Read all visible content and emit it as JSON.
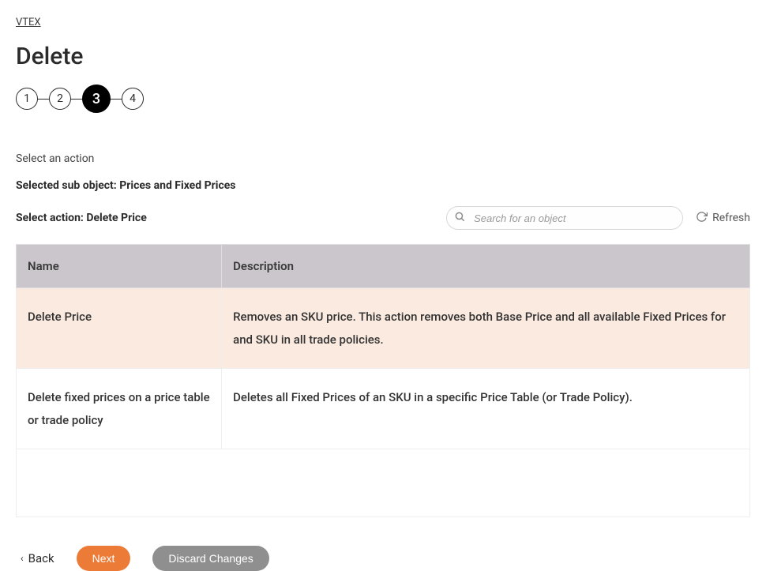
{
  "breadcrumb": {
    "label": "VTEX"
  },
  "page": {
    "title": "Delete"
  },
  "stepper": {
    "steps": [
      {
        "num": "1",
        "active": false
      },
      {
        "num": "2",
        "active": false
      },
      {
        "num": "3",
        "active": true
      },
      {
        "num": "4",
        "active": false
      }
    ]
  },
  "labels": {
    "select_action": "Select an action",
    "selected_sub_object": "Selected sub object: Prices and Fixed Prices",
    "select_action_value": "Select action: Delete Price"
  },
  "search": {
    "placeholder": "Search for an object"
  },
  "refresh": {
    "label": "Refresh"
  },
  "table": {
    "headers": {
      "name": "Name",
      "description": "Description"
    },
    "rows": [
      {
        "name": "Delete Price",
        "description": "Removes an SKU price. This action removes both Base Price and all available Fixed Prices for and SKU in all trade policies.",
        "selected": true
      },
      {
        "name": "Delete fixed prices on a price table or trade policy",
        "description": "Deletes all Fixed Prices of an SKU in a specific Price Table (or Trade Policy).",
        "selected": false
      }
    ]
  },
  "footer": {
    "back": "Back",
    "next": "Next",
    "discard": "Discard Changes"
  }
}
